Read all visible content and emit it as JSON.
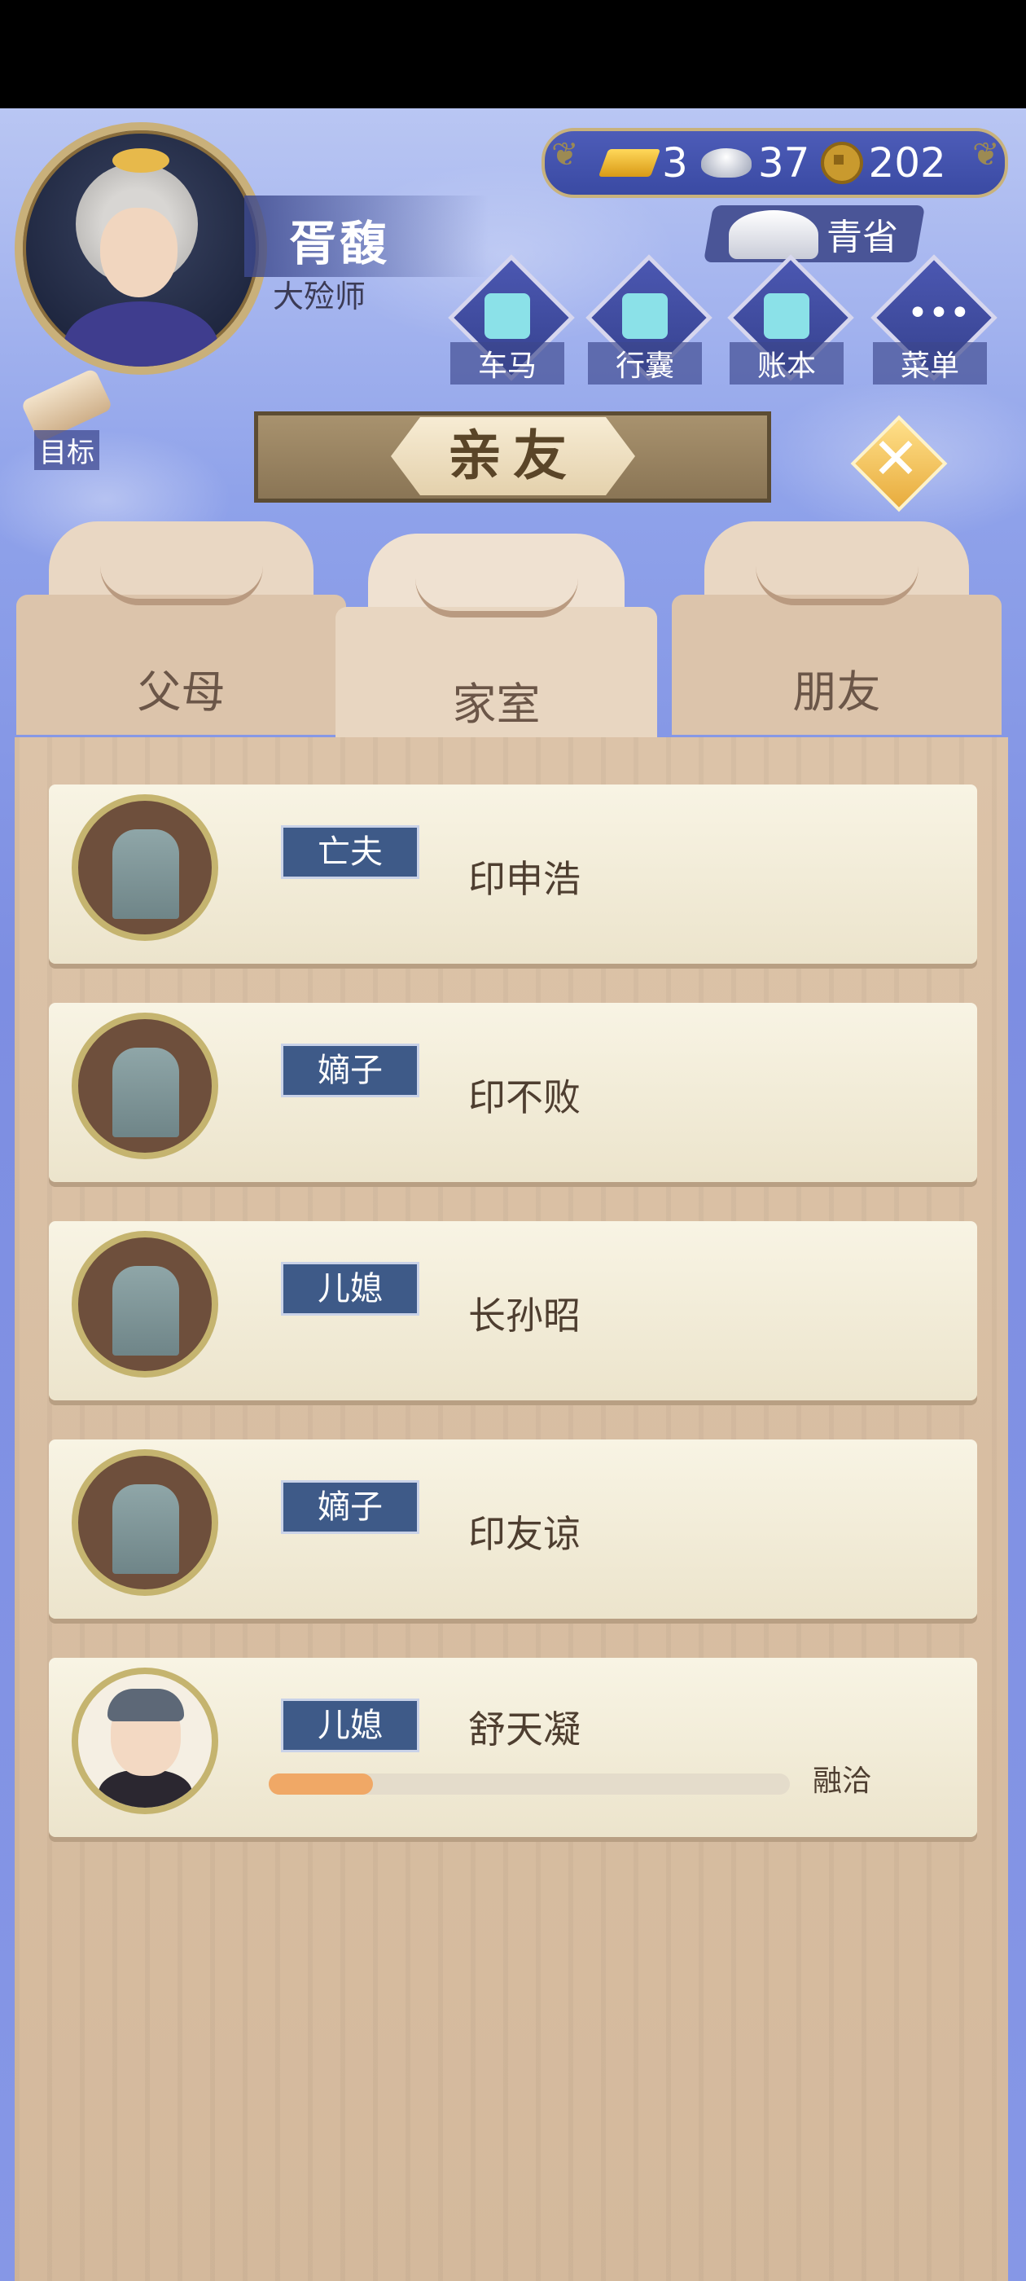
{
  "header": {
    "player_name": "胥馥",
    "player_title": "大殓师",
    "province": "青省",
    "currency": {
      "gold": "3",
      "silver": "37",
      "coins": "202"
    }
  },
  "nav": [
    {
      "label": "车马",
      "icon": "carriage-icon"
    },
    {
      "label": "行囊",
      "icon": "bag-icon"
    },
    {
      "label": "账本",
      "icon": "ledger-icon"
    },
    {
      "label": "菜单",
      "icon": "menu-dots-icon"
    }
  ],
  "target_label": "目标",
  "title": "亲友",
  "tabs": [
    {
      "label": "父母",
      "active": false
    },
    {
      "label": "家室",
      "active": true
    },
    {
      "label": "朋友",
      "active": false
    }
  ],
  "members": [
    {
      "relation": "亡夫",
      "name": "印申浩",
      "portrait": "tombstone-icon"
    },
    {
      "relation": "嫡子",
      "name": "印不败",
      "portrait": "tombstone-icon"
    },
    {
      "relation": "儿媳",
      "name": "长孙昭",
      "portrait": "tombstone-icon"
    },
    {
      "relation": "嫡子",
      "name": "印友谅",
      "portrait": "tombstone-icon"
    },
    {
      "relation": "儿媳",
      "name": "舒天凝",
      "portrait": "person-portrait",
      "affinity": 0.2,
      "affinity_label": "融洽"
    }
  ]
}
